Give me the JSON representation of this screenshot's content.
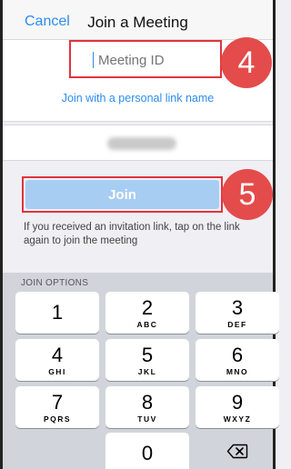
{
  "navbar": {
    "cancel_label": "Cancel",
    "title": "Join a Meeting"
  },
  "form": {
    "meeting_id_placeholder": "Meeting ID",
    "meeting_id_value": "",
    "personal_link_label": "Join with a personal link name",
    "display_name_blurred": true,
    "join_label": "Join",
    "hint": "If you received an invitation link, tap on the link again to join the meeting"
  },
  "annotations": {
    "step_a": "4",
    "step_b": "5",
    "color": "#e0343c"
  },
  "keyboard": {
    "header": "JOIN OPTIONS",
    "keys": [
      {
        "digit": "1",
        "letters": ""
      },
      {
        "digit": "2",
        "letters": "ABC"
      },
      {
        "digit": "3",
        "letters": "DEF"
      },
      {
        "digit": "4",
        "letters": "GHI"
      },
      {
        "digit": "5",
        "letters": "JKL"
      },
      {
        "digit": "6",
        "letters": "MNO"
      },
      {
        "digit": "7",
        "letters": "PQRS"
      },
      {
        "digit": "8",
        "letters": "TUV"
      },
      {
        "digit": "9",
        "letters": "WXYZ"
      },
      {
        "digit": "0",
        "letters": ""
      }
    ],
    "delete_icon": "backspace-icon"
  },
  "colors": {
    "accent": "#2d8cf0",
    "join_button": "#a8cdf2",
    "badge": "#e44b4b"
  }
}
